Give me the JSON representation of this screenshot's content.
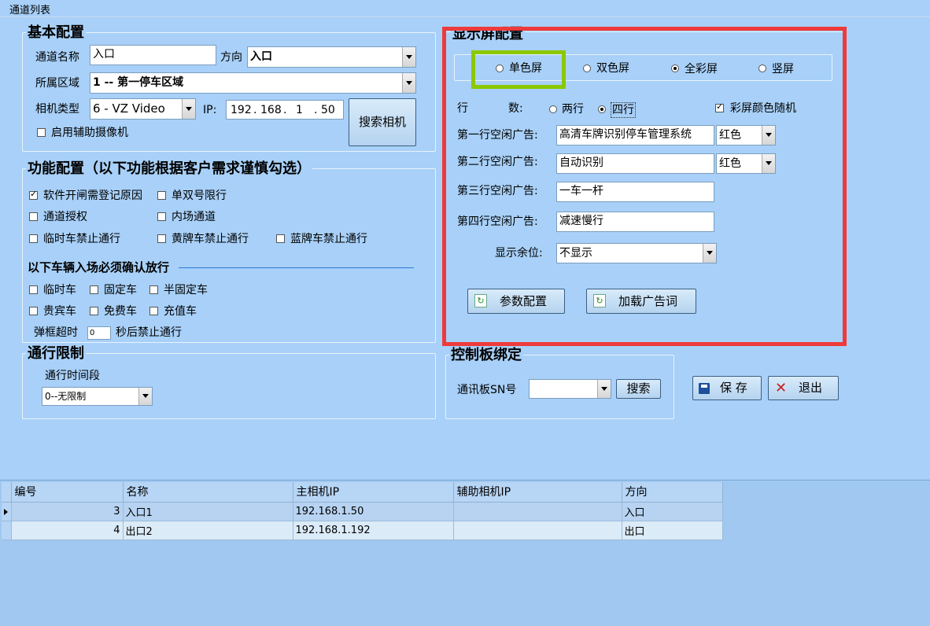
{
  "window": {
    "tab_title": "通道列表"
  },
  "basic": {
    "title": "基本配置",
    "channel_name_label": "通道名称",
    "channel_name_value": "入口",
    "direction_label": "方向",
    "direction_value": "入口",
    "area_label": "所属区域",
    "area_value": "1 -- 第一停车区域",
    "camera_type_label": "相机类型",
    "camera_type_value": "6 - VZ Video",
    "ip_label": "IP:",
    "ip_octets": [
      "192",
      "168",
      "1",
      "50"
    ],
    "search_camera_label": "搜索相机",
    "aux_camera_label": "启用辅助摄像机"
  },
  "functions": {
    "title": "功能配置（以下功能根据客户需求谨慎勾选）",
    "items": [
      {
        "label": "软件开闸需登记原因",
        "checked": true
      },
      {
        "label": "单双号限行",
        "checked": false
      },
      {
        "label": "通道授权",
        "checked": false
      },
      {
        "label": "内场通道",
        "checked": false
      },
      {
        "label": "临时车禁止通行",
        "checked": false
      },
      {
        "label": "黄牌车禁止通行",
        "checked": false
      },
      {
        "label": "蓝牌车禁止通行",
        "checked": false
      }
    ],
    "confirm_title": "以下车辆入场必须确认放行",
    "confirm_items": [
      {
        "label": "临时车",
        "checked": false
      },
      {
        "label": "固定车",
        "checked": false
      },
      {
        "label": "半固定车",
        "checked": false
      },
      {
        "label": "贵宾车",
        "checked": false
      },
      {
        "label": "免费车",
        "checked": false
      },
      {
        "label": "充值车",
        "checked": false
      }
    ],
    "popup_timeout_prefix": "弹框超时",
    "popup_timeout_value": "0",
    "popup_timeout_suffix": "秒后禁止通行"
  },
  "limit": {
    "title": "通行限制",
    "period_label": "通行时间段",
    "period_value": "0--无限制"
  },
  "display": {
    "title": "显示屏配置",
    "screen_types": [
      {
        "label": "单色屏",
        "selected": false
      },
      {
        "label": "双色屏",
        "selected": false
      },
      {
        "label": "全彩屏",
        "selected": true
      },
      {
        "label": "竖屏",
        "selected": false
      }
    ],
    "rows_label_a": "行",
    "rows_label_b": "数:",
    "row_options": [
      {
        "label": "两行",
        "selected": false
      },
      {
        "label": "四行",
        "selected": true
      }
    ],
    "random_color_label": "彩屏颜色随机",
    "random_color_checked": true,
    "line1_label": "第一行空闲广告:",
    "line1_value": "高清车牌识别停车管理系统",
    "line1_color": "红色",
    "line2_label": "第二行空闲广告:",
    "line2_value": "自动识别",
    "line2_color": "红色",
    "line3_label": "第三行空闲广告:",
    "line3_value": "一车一杆",
    "line4_label": "第四行空闲广告:",
    "line4_value": "减速慢行",
    "remain_label": "显示余位:",
    "remain_value": "不显示",
    "param_button": "参数配置",
    "ad_button": "加载广告词"
  },
  "board": {
    "title": "控制板绑定",
    "sn_label": "通讯板SN号",
    "sn_value": "",
    "search_button": "搜索"
  },
  "actions": {
    "save_button": "保 存",
    "exit_button": "退出"
  },
  "table": {
    "headers": [
      "编号",
      "名称",
      "主相机IP",
      "辅助相机IP",
      "方向"
    ],
    "rows": [
      {
        "id": "3",
        "name": "入口1",
        "main_ip": "192.168.1.50",
        "aux_ip": "",
        "direction": "入口"
      },
      {
        "id": "4",
        "name": "出口2",
        "main_ip": "192.168.1.192",
        "aux_ip": "",
        "direction": "出口"
      }
    ]
  },
  "colors": {
    "background": "#a8d0f8",
    "highlight_red": "#ee3a3a",
    "highlight_green": "#8cc800"
  }
}
